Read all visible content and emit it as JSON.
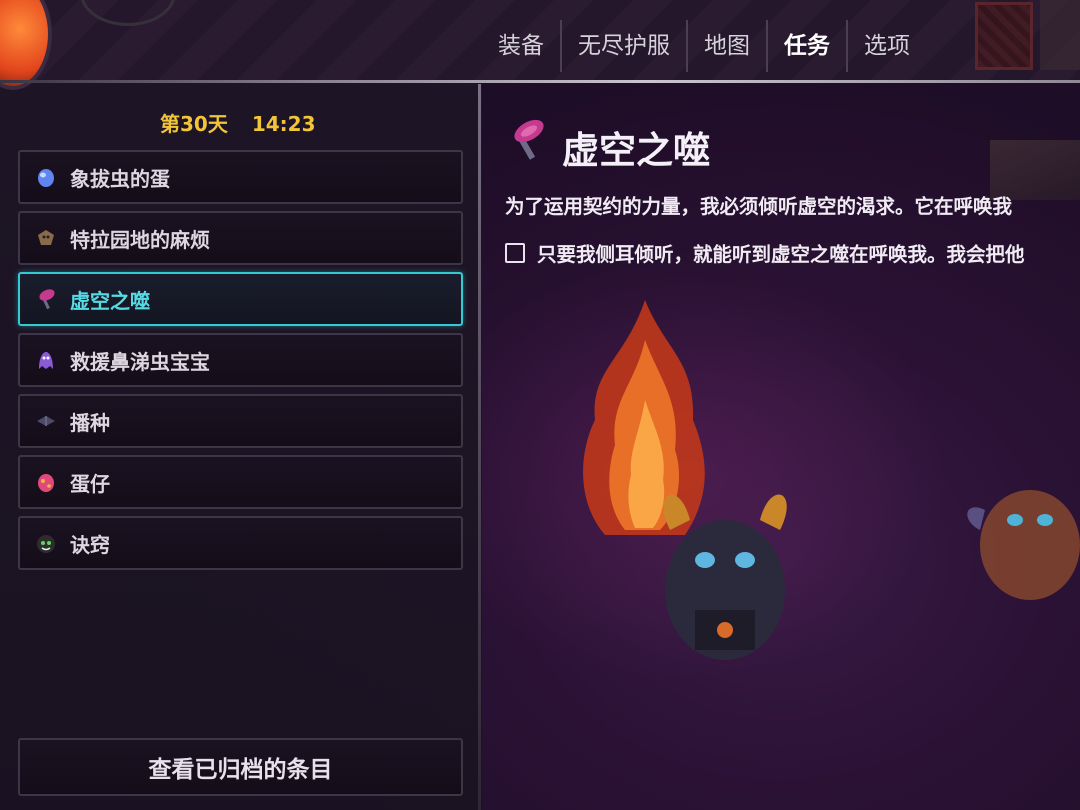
{
  "nav": {
    "items": [
      "装备",
      "无尽护服",
      "地图",
      "任务",
      "选项"
    ],
    "active_index": 3
  },
  "status": {
    "day": "第30天",
    "time": "14:23"
  },
  "quests": [
    {
      "label": "象拔虫的蛋",
      "icon": "blue-egg-icon"
    },
    {
      "label": "特拉园地的麻烦",
      "icon": "creature-head-icon"
    },
    {
      "label": "虚空之噬",
      "icon": "void-hammer-icon",
      "selected": true
    },
    {
      "label": "救援鼻涕虫宝宝",
      "icon": "ghost-slug-icon"
    },
    {
      "label": "播种",
      "icon": "seed-icon"
    },
    {
      "label": "蛋仔",
      "icon": "pink-egg-icon"
    },
    {
      "label": "诀窍",
      "icon": "tips-face-icon"
    }
  ],
  "archive_button": "查看已归档的条目",
  "detail": {
    "icon": "void-hammer-icon",
    "title": "虚空之噬",
    "description": "为了运用契约的力量，我必须倾听虚空的渴求。它在呼唤我",
    "objective": "只要我侧耳倾听，就能听到虚空之噬在呼唤我。我会把他"
  },
  "colors": {
    "accent_selected": "#35c9d4",
    "day_time": "#f2c438"
  }
}
